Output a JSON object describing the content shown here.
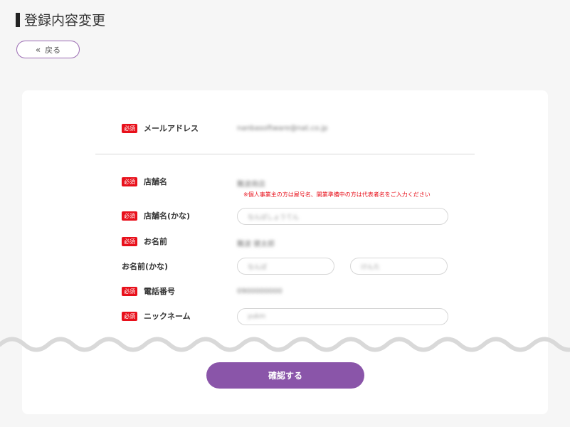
{
  "header": {
    "title": "登録内容変更",
    "back_label": "戻る",
    "back_icon": "double-chevron-left"
  },
  "form": {
    "required_badge": "必須",
    "email": {
      "label": "メールアドレス",
      "value": "nanbasoftware@nat.co.jp"
    },
    "shop_name": {
      "label": "店舗名",
      "value": "難波商店",
      "note": "※個人事業主の方は屋号名、開業準備中の方は代表者名をご入力ください"
    },
    "shop_name_kana": {
      "label": "店舗名(かな)",
      "value": "なんばしょうてん"
    },
    "name": {
      "label": "お名前",
      "value": "難波 健太郎"
    },
    "name_kana": {
      "label": "お名前(かな)",
      "last": "なんば",
      "first": "けんた"
    },
    "phone": {
      "label": "電話番号",
      "value": "0900000000"
    },
    "nickname": {
      "label": "ニックネーム",
      "value": "yukm"
    }
  },
  "actions": {
    "confirm_label": "確認する"
  },
  "colors": {
    "accent": "#8a55a9",
    "required": "#e8101b",
    "background": "#f6f6f6"
  }
}
